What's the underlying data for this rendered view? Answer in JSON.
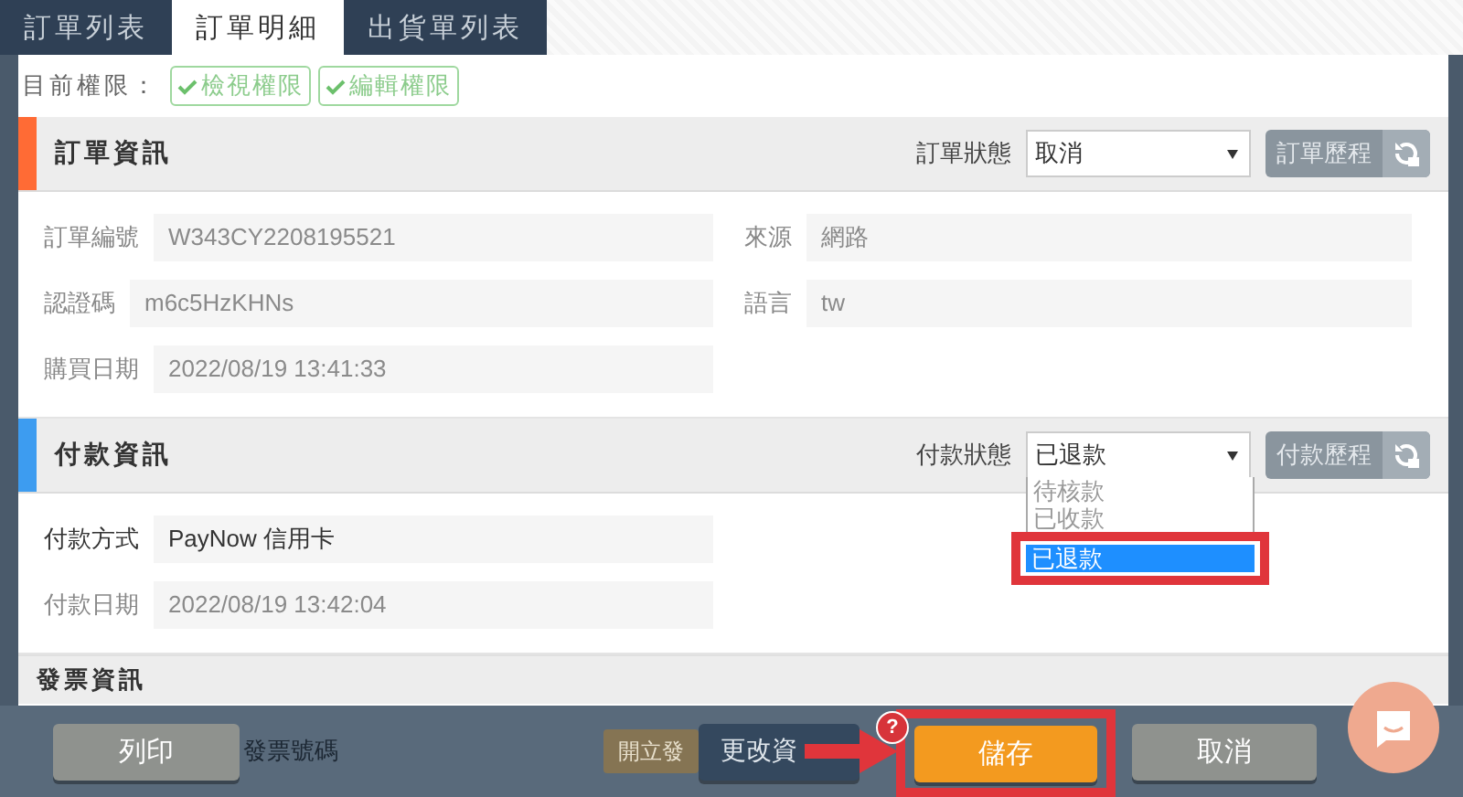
{
  "tabs": [
    {
      "label": "訂單列表",
      "selected": false
    },
    {
      "label": "訂單明細",
      "selected": true
    },
    {
      "label": "出貨單列表",
      "selected": false
    }
  ],
  "permissions": {
    "label": "目前權限：",
    "badges": [
      "檢視權限",
      "編輯權限"
    ]
  },
  "sections": [
    {
      "title": "訂單資訊",
      "color": "#ff6b35",
      "status": {
        "label": "訂單狀態",
        "value": "取消"
      },
      "history_button": "訂單歷程",
      "left_fields": [
        {
          "label": "訂單編號",
          "value": "W343CY2208195521",
          "disabled": true
        },
        {
          "label": "認證碼",
          "value": "m6c5HzKHNs",
          "disabled": true
        },
        {
          "label": "購買日期",
          "value": "2022/08/19 13:41:33",
          "disabled": true
        }
      ],
      "right_fields": [
        {
          "label": "來源",
          "value": "網路",
          "disabled": true
        },
        {
          "label": "語言",
          "value": "tw",
          "disabled": true
        }
      ]
    },
    {
      "title": "付款資訊",
      "color": "#3d9cf0",
      "status": {
        "label": "付款狀態",
        "value": "已退款",
        "options": [
          {
            "label": "待核款",
            "selected": false,
            "highlighted": false
          },
          {
            "label": "已收款",
            "selected": false,
            "highlighted": false
          },
          {
            "label": "已退款",
            "selected": true,
            "highlighted": true
          }
        ]
      },
      "history_button": "付款歷程",
      "left_fields": [
        {
          "label": "付款方式",
          "value": "PayNow 信用卡",
          "disabled": false
        },
        {
          "label": "付款日期",
          "value": "2022/08/19 13:42:04",
          "disabled": true
        }
      ]
    }
  ],
  "invoice": {
    "title": "發票資訊",
    "number_label": "發票號碼",
    "issue_button": "開立發"
  },
  "footer_buttons": [
    {
      "label": "列印",
      "kind": "neutral",
      "highlighted": false
    },
    {
      "label": "更改資",
      "kind": "dark",
      "badge": "?",
      "highlighted": false
    },
    {
      "label": "儲存",
      "kind": "primary",
      "highlighted": true
    },
    {
      "label": "取消",
      "kind": "neutral",
      "highlighted": false
    }
  ]
}
